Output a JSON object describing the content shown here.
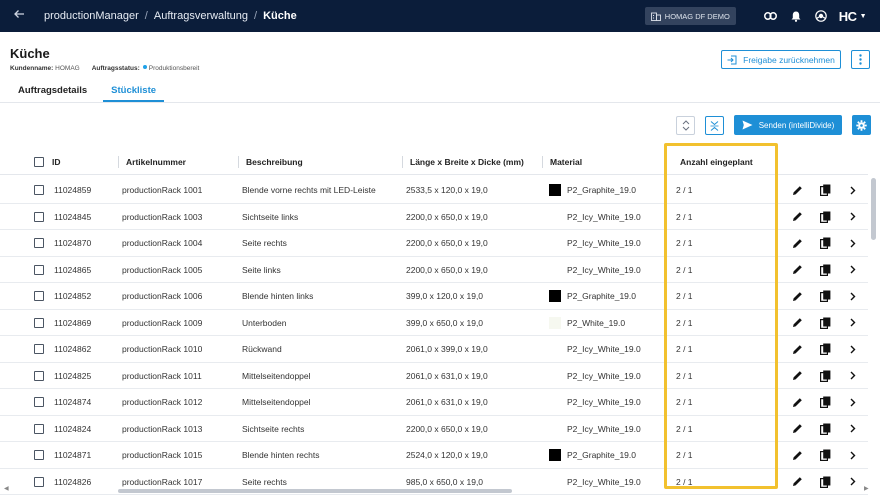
{
  "topbar": {
    "breadcrumb": [
      "productionManager",
      "Auftragsverwaltung",
      "Küche"
    ],
    "separator": "/",
    "workspace_label": "HOMAG DF DEMO",
    "logo_text": "HC",
    "colors": {
      "bar": "#0b1d3a"
    }
  },
  "header": {
    "title": "Küche",
    "customer_label": "Kundenname:",
    "customer_value": "HOMAG",
    "status_label": "Auftragsstatus:",
    "status_value": "Produktionsbereit",
    "release_button": "Freigabe zurücknehmen"
  },
  "tabs": [
    {
      "label": "Auftragsdetails",
      "active": false
    },
    {
      "label": "Stückliste",
      "active": true
    }
  ],
  "toolbar": {
    "send_label": "Senden (intelliDivide)"
  },
  "table": {
    "columns": {
      "id": "ID",
      "article": "Artikelnummer",
      "description": "Beschreibung",
      "dimensions": "Länge x Breite x Dicke (mm)",
      "material": "Material",
      "planned": "Anzahl eingeplant"
    },
    "rows": [
      {
        "id": "11024859",
        "article": "productionRack 1001",
        "description": "Blende vorne rechts mit LED-Leiste",
        "dimensions": "2533,5 x 120,0 x 19,0",
        "material": "P2_Graphite_19.0",
        "swatch": "#000000",
        "planned": "2 / 1"
      },
      {
        "id": "11024845",
        "article": "productionRack 1003",
        "description": "Sichtseite links",
        "dimensions": "2200,0 x 650,0 x 19,0",
        "material": "P2_Icy_White_19.0",
        "swatch": "",
        "planned": "2 / 1"
      },
      {
        "id": "11024870",
        "article": "productionRack 1004",
        "description": "Seite rechts",
        "dimensions": "2200,0 x 650,0 x 19,0",
        "material": "P2_Icy_White_19.0",
        "swatch": "",
        "planned": "2 / 1"
      },
      {
        "id": "11024865",
        "article": "productionRack 1005",
        "description": "Seite links",
        "dimensions": "2200,0 x 650,0 x 19,0",
        "material": "P2_Icy_White_19.0",
        "swatch": "",
        "planned": "2 / 1"
      },
      {
        "id": "11024852",
        "article": "productionRack 1006",
        "description": "Blende hinten links",
        "dimensions": "399,0 x 120,0 x 19,0",
        "material": "P2_Graphite_19.0",
        "swatch": "#000000",
        "planned": "2 / 1"
      },
      {
        "id": "11024869",
        "article": "productionRack 1009",
        "description": "Unterboden",
        "dimensions": "399,0 x 650,0 x 19,0",
        "material": "P2_White_19.0",
        "swatch": "#f6f8f0",
        "planned": "2 / 1"
      },
      {
        "id": "11024862",
        "article": "productionRack 1010",
        "description": "Rückwand",
        "dimensions": "2061,0 x 399,0 x 19,0",
        "material": "P2_Icy_White_19.0",
        "swatch": "",
        "planned": "2 / 1"
      },
      {
        "id": "11024825",
        "article": "productionRack 1011",
        "description": "Mittelseitendoppel",
        "dimensions": "2061,0 x 631,0 x 19,0",
        "material": "P2_Icy_White_19.0",
        "swatch": "",
        "planned": "2 / 1"
      },
      {
        "id": "11024874",
        "article": "productionRack 1012",
        "description": "Mittelseitendoppel",
        "dimensions": "2061,0 x 631,0 x 19,0",
        "material": "P2_Icy_White_19.0",
        "swatch": "",
        "planned": "2 / 1"
      },
      {
        "id": "11024824",
        "article": "productionRack 1013",
        "description": "Sichtseite rechts",
        "dimensions": "2200,0 x 650,0 x 19,0",
        "material": "P2_Icy_White_19.0",
        "swatch": "",
        "planned": "2 / 1"
      },
      {
        "id": "11024871",
        "article": "productionRack 1015",
        "description": "Blende hinten rechts",
        "dimensions": "2524,0 x 120,0 x 19,0",
        "material": "P2_Graphite_19.0",
        "swatch": "#000000",
        "planned": "2 / 1"
      },
      {
        "id": "11024826",
        "article": "productionRack 1017",
        "description": "Seite rechts",
        "dimensions": "985,0 x 650,0 x 19,0",
        "material": "P2_Icy_White_19.0",
        "swatch": "",
        "planned": "2 / 1"
      }
    ]
  },
  "colors": {
    "accent": "#1e8fd6",
    "highlight": "#f2c12e",
    "status_dot": "#1fa1e8"
  }
}
